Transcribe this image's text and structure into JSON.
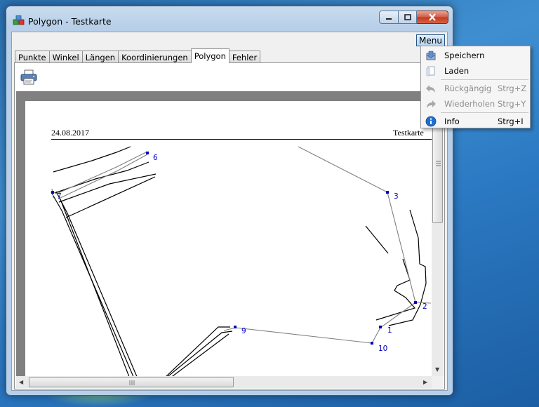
{
  "window": {
    "title": "Polygon - Testkarte",
    "colors": {
      "accent": "#26548a",
      "close": "#c23a22",
      "lines": "#000000",
      "polygon": "#808080",
      "points": "#0000c8"
    }
  },
  "menu_button": {
    "label": "Menu"
  },
  "tabs": [
    {
      "label": "Punkte",
      "active": false
    },
    {
      "label": "Winkel",
      "active": false
    },
    {
      "label": "Längen",
      "active": false
    },
    {
      "label": "Koordinierungen",
      "active": false
    },
    {
      "label": "Polygon",
      "active": true
    },
    {
      "label": "Fehler",
      "active": false
    }
  ],
  "toolbar": {
    "print_icon": "printer-icon"
  },
  "page": {
    "date": "24.08.2017",
    "name": "Testkarte",
    "points": [
      {
        "label": "1"
      },
      {
        "label": "2"
      },
      {
        "label": "3"
      },
      {
        "label": "6"
      },
      {
        "label": "7"
      },
      {
        "label": "9"
      },
      {
        "label": "10"
      }
    ]
  },
  "dropdown": {
    "items": [
      {
        "label": "Speichern",
        "shortcut": "",
        "icon": "save-icon",
        "enabled": true
      },
      {
        "label": "Laden",
        "shortcut": "",
        "icon": "load-icon",
        "enabled": true
      },
      {
        "label": "Rückgängig",
        "shortcut": "Strg+Z",
        "icon": "undo-icon",
        "enabled": false
      },
      {
        "label": "Wiederholen",
        "shortcut": "Strg+Y",
        "icon": "redo-icon",
        "enabled": false
      },
      {
        "label": "Info",
        "shortcut": "Strg+I",
        "icon": "info-icon",
        "enabled": true
      }
    ]
  }
}
